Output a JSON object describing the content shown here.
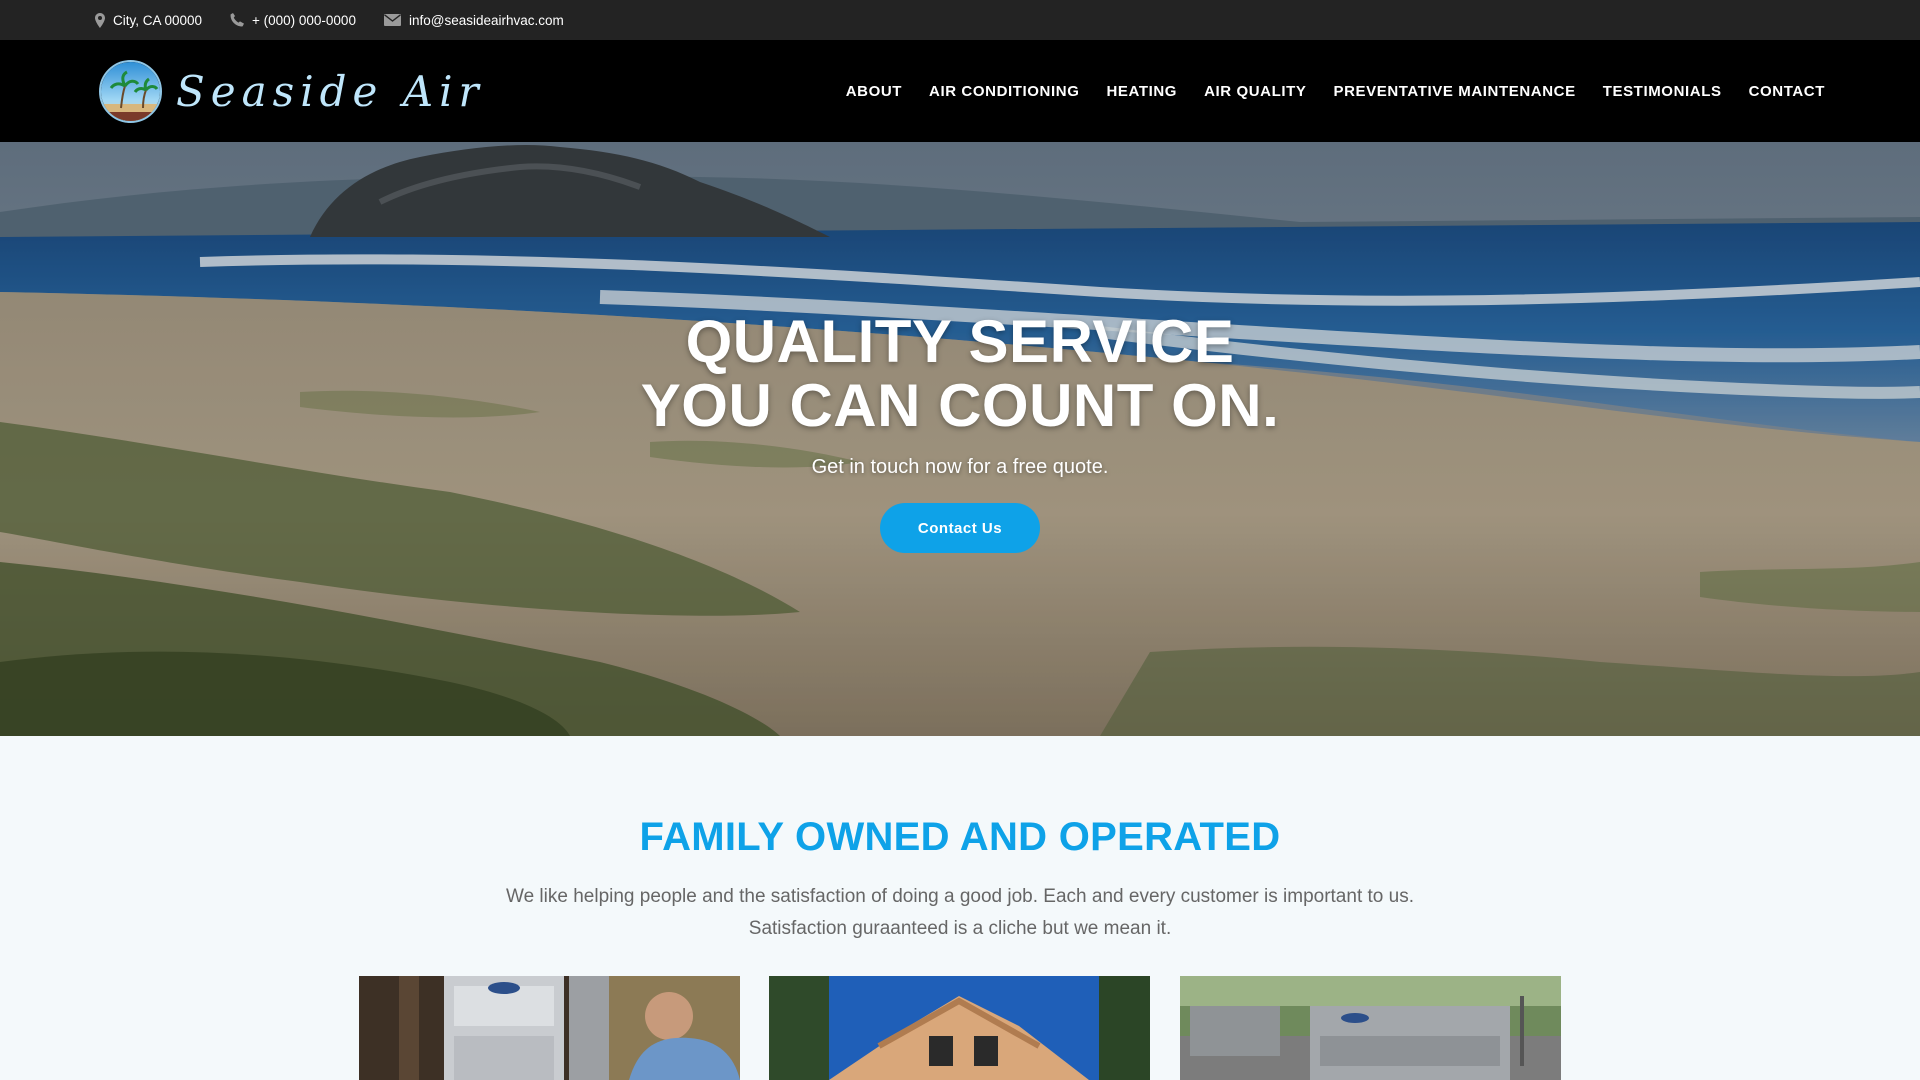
{
  "topbar": {
    "location": "City, CA 00000",
    "phone": "+ (000) 000-0000",
    "email": "info@seasideairhvac.com"
  },
  "brand": {
    "name": "Seaside Air"
  },
  "nav": {
    "items": [
      "ABOUT",
      "AIR CONDITIONING",
      "HEATING",
      "AIR QUALITY",
      "PREVENTATIVE MAINTENANCE",
      "TESTIMONIALS",
      "CONTACT"
    ]
  },
  "hero": {
    "title_line1": "QUALITY SERVICE",
    "title_line2": "YOU CAN COUNT ON.",
    "subtitle": "Get in touch now for a free quote.",
    "cta": "Contact Us"
  },
  "about": {
    "title": "FAMILY OWNED AND OPERATED",
    "line1": "We like helping people and the satisfaction of doing a good job. Each and every customer is important to us.",
    "line2": "Satisfaction guraanteed is a cliche but we mean it."
  },
  "colors": {
    "accent": "#0ea2e8",
    "topbar_bg": "#232323",
    "header_bg": "#000000",
    "section_bg": "#f4f9fb"
  },
  "icons": [
    "map-marker-icon",
    "phone-icon",
    "envelope-icon"
  ]
}
